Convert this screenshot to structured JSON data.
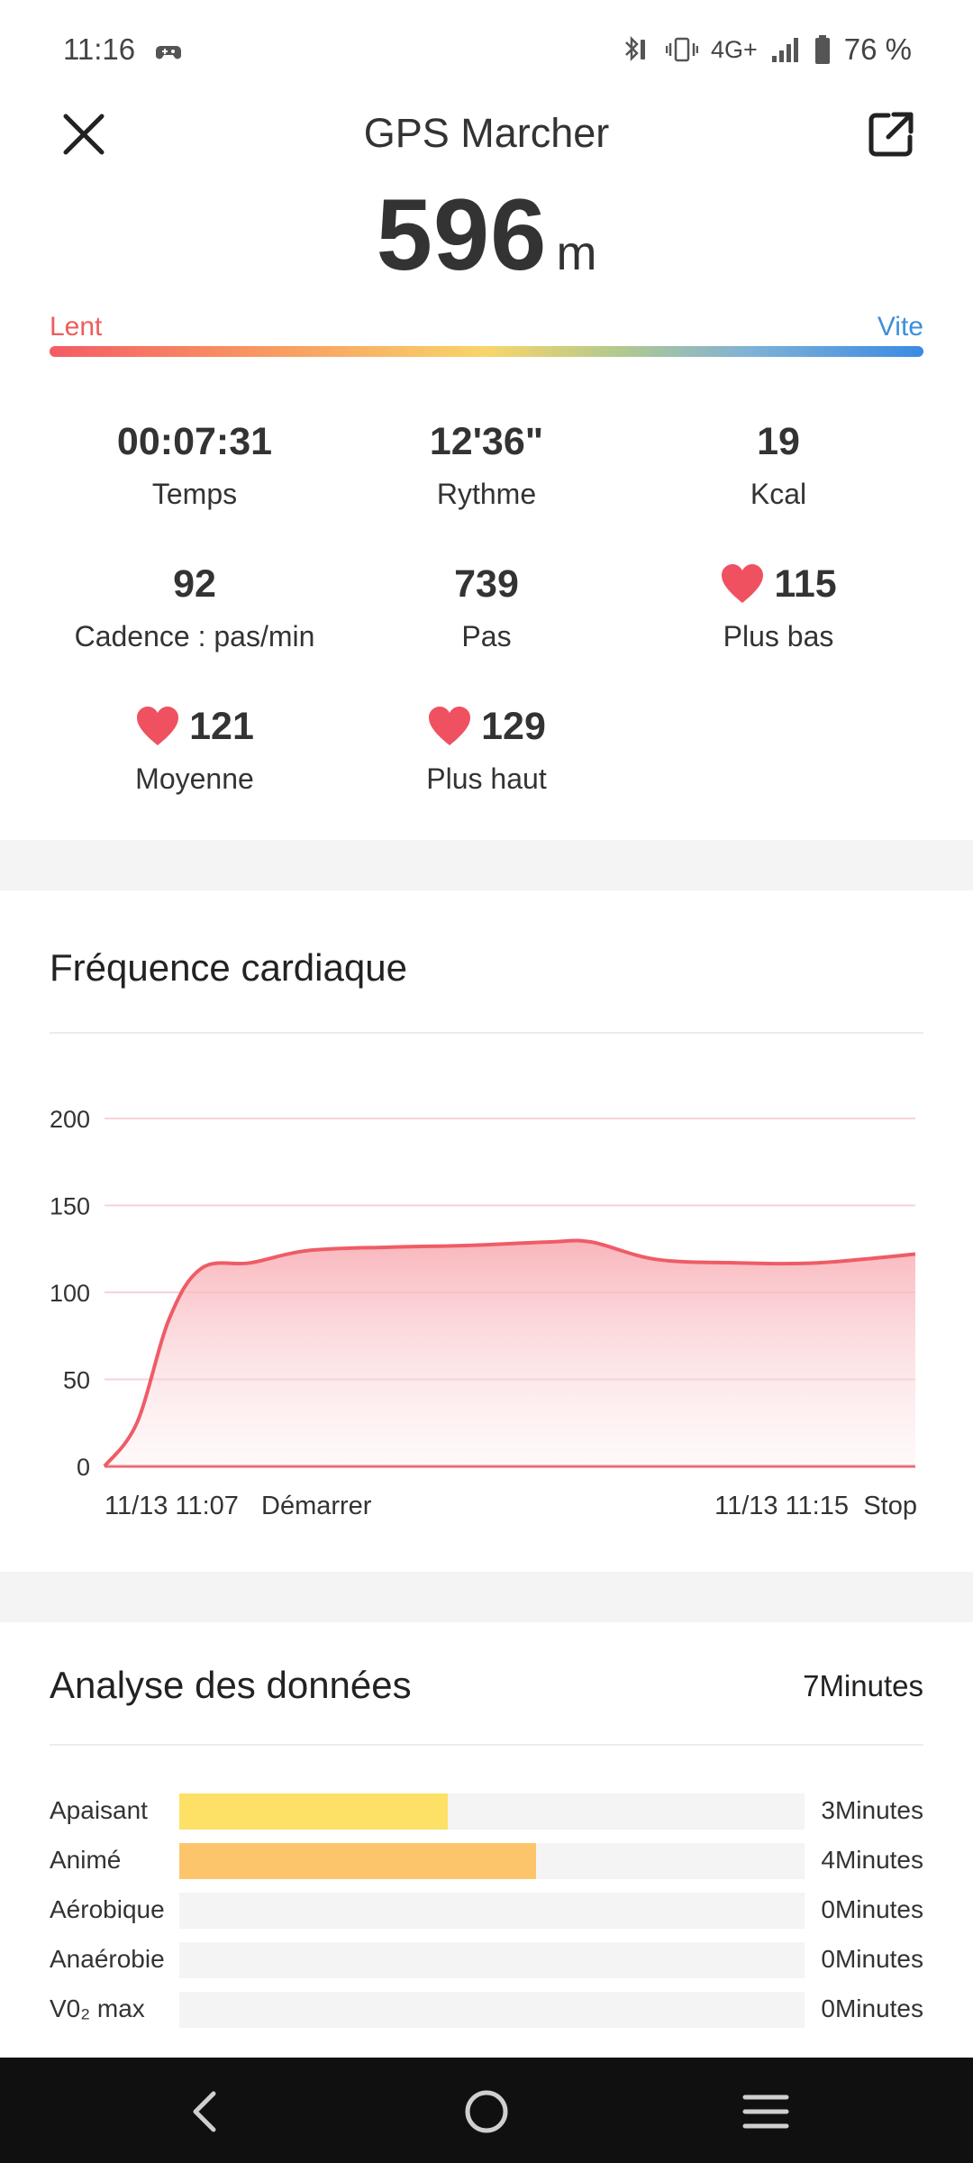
{
  "status_bar": {
    "time": "11:16",
    "network": "4G+",
    "battery": "76 %"
  },
  "header": {
    "title": "GPS Marcher",
    "distance_value": "596",
    "distance_unit": "m"
  },
  "speed_scale": {
    "slow_label": "Lent",
    "fast_label": "Vite"
  },
  "stats": [
    {
      "value": "00:07:31",
      "label": "Temps",
      "heart": false
    },
    {
      "value": "12'36\"",
      "label": "Rythme",
      "heart": false
    },
    {
      "value": "19",
      "label": "Kcal",
      "heart": false
    },
    {
      "value": "92",
      "label": "Cadence : pas/min",
      "heart": false
    },
    {
      "value": "739",
      "label": "Pas",
      "heart": false
    },
    {
      "value": "115",
      "label": "Plus bas",
      "heart": true
    },
    {
      "value": "121",
      "label": "Moyenne",
      "heart": true
    },
    {
      "value": "129",
      "label": "Plus haut",
      "heart": true
    }
  ],
  "heart_rate": {
    "title": "Fréquence cardiaque",
    "start_time": "11/13 11:07",
    "start_label": "Démarrer",
    "end_time": "11/13 11:15",
    "end_label": "Stop"
  },
  "chart_data": {
    "type": "area",
    "title": "Fréquence cardiaque",
    "ylim": [
      0,
      200
    ],
    "yticks": [
      "0",
      "50",
      "100",
      "150",
      "200"
    ],
    "x": [
      0,
      0.04,
      0.08,
      0.12,
      0.18,
      0.25,
      0.35,
      0.45,
      0.55,
      0.6,
      0.68,
      0.78,
      0.88,
      1.0
    ],
    "series": [
      {
        "values": [
          0,
          25,
          85,
          114,
          117,
          124,
          126,
          127,
          129,
          129,
          119,
          117,
          117,
          122
        ]
      }
    ],
    "line_color": "#ef5c66",
    "grid": true
  },
  "analysis": {
    "title": "Analyse des données",
    "total": "7Minutes",
    "zones": [
      {
        "label": "Apaisant",
        "time": "3Minutes",
        "fraction": 0.43,
        "color": "#fde066"
      },
      {
        "label": "Animé",
        "time": "4Minutes",
        "fraction": 0.57,
        "color": "#fdc56b"
      },
      {
        "label": "Aérobique",
        "time": "0Minutes",
        "fraction": 0,
        "color": "#f5a45b"
      },
      {
        "label": "Anaérobie",
        "time": "0Minutes",
        "fraction": 0,
        "color": "#f27e5d"
      },
      {
        "label": "V0₂ max",
        "time": "0Minutes",
        "fraction": 0,
        "color": "#ef5c5c"
      }
    ]
  },
  "nav": {
    "icons": [
      "back-icon",
      "home-icon",
      "recents-icon"
    ]
  }
}
